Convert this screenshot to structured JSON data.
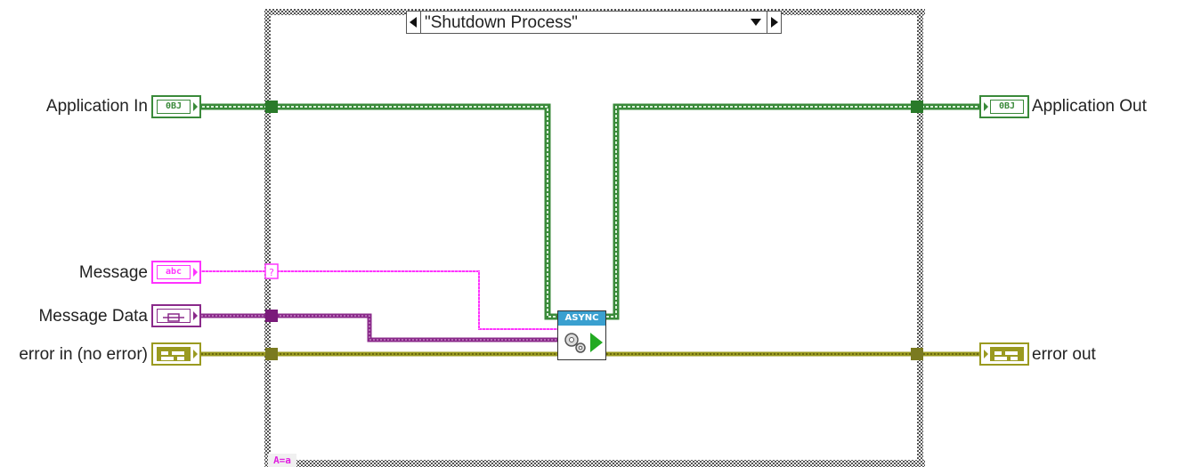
{
  "case_selector": {
    "value": "\"Shutdown Process\""
  },
  "inputs": {
    "application_in": {
      "label": "Application In",
      "glyph": "0BJ"
    },
    "message": {
      "label": "Message",
      "glyph": "abc"
    },
    "message_data": {
      "label": "Message Data",
      "glyph": ""
    },
    "error_in": {
      "label": "error in (no error)",
      "glyph": ""
    }
  },
  "outputs": {
    "application_out": {
      "label": "Application Out",
      "glyph": "0BJ"
    },
    "error_out": {
      "label": "error out",
      "glyph": ""
    }
  },
  "async_node": {
    "header": "ASYNC",
    "icon": "gears-run-icon"
  },
  "case_marker": {
    "text": "A=a"
  },
  "colors": {
    "object_wire": "#3a8a3a",
    "string_wire": "#ff33ff",
    "variant_wire": "#8a2a8a",
    "error_wire": "#9a9a20",
    "structure_border": "#555555"
  }
}
